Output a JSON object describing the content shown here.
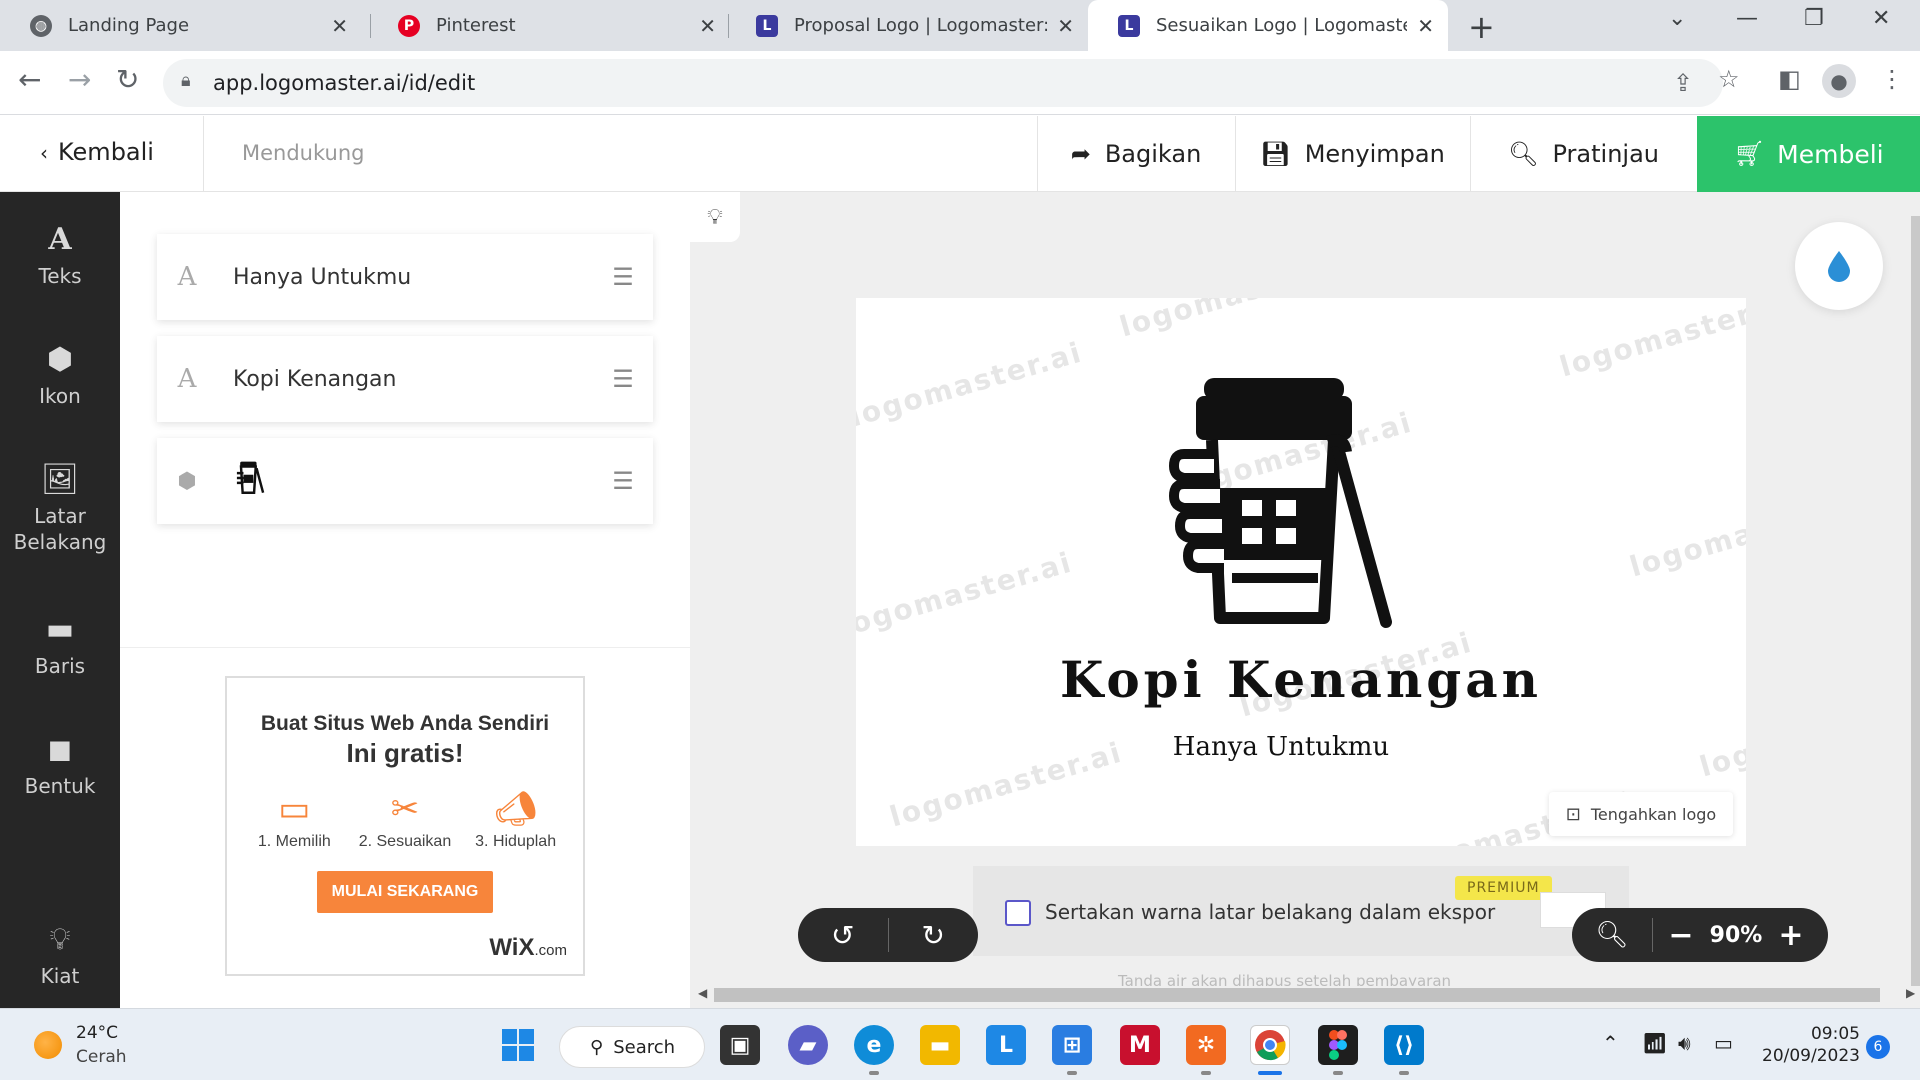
{
  "browser": {
    "tabs": [
      {
        "title": "Landing Page",
        "favicon": "globe-icon"
      },
      {
        "title": "Pinterest",
        "favicon": "pinterest-icon"
      },
      {
        "title": "Proposal Logo | Logomaster: Pem",
        "favicon": "logomaster-icon"
      },
      {
        "title": "Sesuaikan Logo | Logomaster: Pe",
        "favicon": "logomaster-icon"
      }
    ],
    "url": "app.logomaster.ai/id/edit"
  },
  "topbar": {
    "back": "Kembali",
    "support": "Mendukung",
    "share": "Bagikan",
    "save": "Menyimpan",
    "preview": "Pratinjau",
    "buy": "Membeli"
  },
  "sidebar": {
    "items": [
      {
        "label": "Teks"
      },
      {
        "label": "Ikon"
      },
      {
        "label": "Latar Belakang"
      },
      {
        "label": "Baris"
      },
      {
        "label": "Bentuk"
      },
      {
        "label": "Kiat"
      }
    ]
  },
  "layers": [
    {
      "type": "text",
      "text": "Hanya Untukmu"
    },
    {
      "type": "text",
      "text": "Kopi Kenangan"
    },
    {
      "type": "icon",
      "icon": "coffee-cup-hand-icon"
    }
  ],
  "ad": {
    "line1": "Buat Situs Web Anda Sendiri",
    "line2": "Ini gratis!",
    "steps": [
      "1. Memilih",
      "2. Sesuaikan",
      "3. Hiduplah"
    ],
    "cta": "MULAI SEKARANG",
    "brand": "WiX",
    "brand_suffix": ".com"
  },
  "canvas": {
    "logo_name": "Kopi Kenangan",
    "tagline": "Hanya Untukmu",
    "watermark": "logomaster.ai",
    "center_button": "Tengahkan logo",
    "export_label": "Sertakan warna latar belakang dalam ekspor",
    "export_checked": false,
    "premium_badge": "PREMIUM",
    "watermark_note": "Tanda air akan dihapus setelah pembayaran",
    "zoom": "90%",
    "accent_color": "#2cc36b"
  },
  "taskbar": {
    "temperature": "24°C",
    "weather": "Cerah",
    "search": "Search",
    "time": "09:05",
    "date": "20/09/2023",
    "notifications": "6"
  }
}
